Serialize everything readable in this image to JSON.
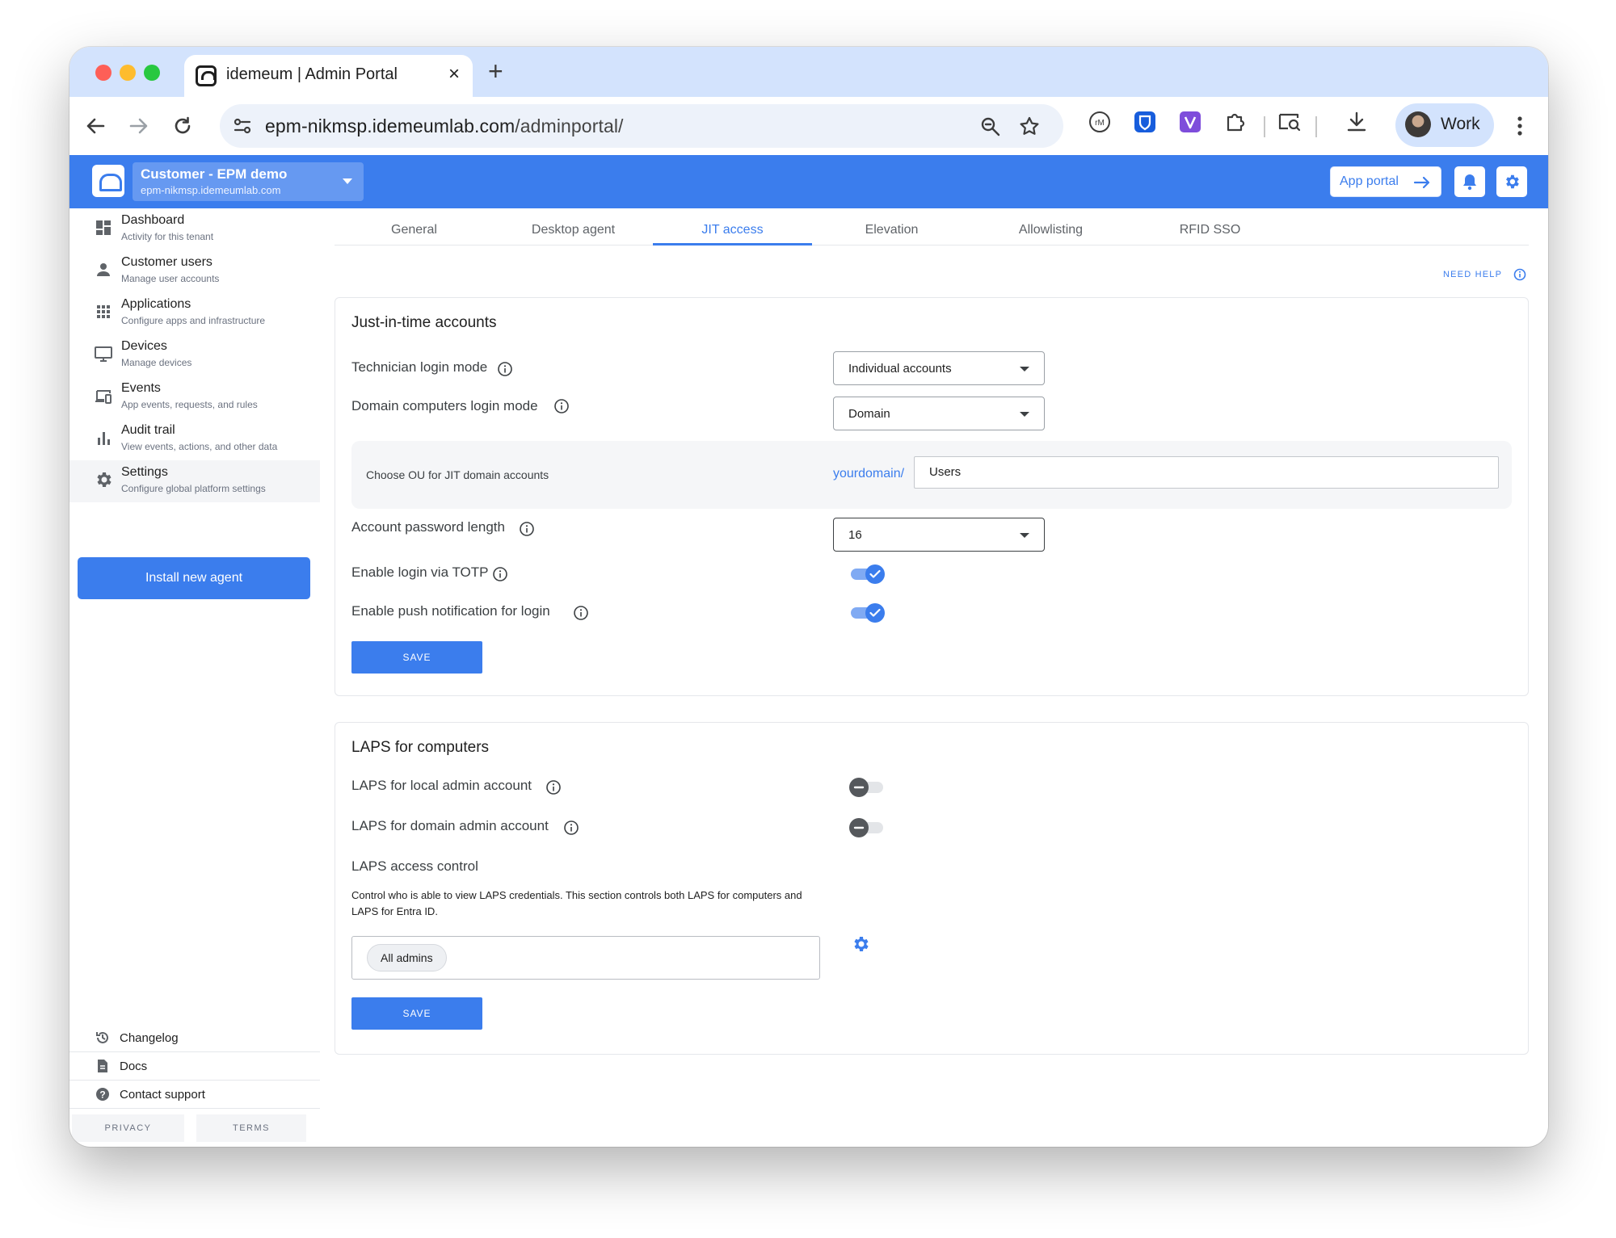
{
  "browser": {
    "tab_title": "idemeum | Admin Portal",
    "tab_close": "×",
    "new_tab": "+",
    "url_host": "epm-nikmsp.idemeumlab.com",
    "url_path": "/adminportal/",
    "profile_label": "Work"
  },
  "header": {
    "tenant_name": "Customer - EPM demo",
    "tenant_domain": "epm-nikmsp.idemeumlab.com",
    "app_portal_label": "App portal"
  },
  "sidebar": {
    "items": [
      {
        "title": "Dashboard",
        "subtitle": "Activity for this tenant",
        "icon": "dashboard-icon"
      },
      {
        "title": "Customer users",
        "subtitle": "Manage user accounts",
        "icon": "person-icon"
      },
      {
        "title": "Applications",
        "subtitle": "Configure apps and infrastructure",
        "icon": "apps-grid-icon"
      },
      {
        "title": "Devices",
        "subtitle": "Manage devices",
        "icon": "monitor-icon"
      },
      {
        "title": "Events",
        "subtitle": "App events, requests, and rules",
        "icon": "devices-icon"
      },
      {
        "title": "Audit trail",
        "subtitle": "View events, actions, and other data",
        "icon": "bar-chart-icon"
      },
      {
        "title": "Settings",
        "subtitle": "Configure global platform settings",
        "icon": "gear-icon"
      }
    ],
    "install_label": "Install new agent",
    "footer": [
      {
        "label": "Changelog",
        "icon": "history-icon"
      },
      {
        "label": "Docs",
        "icon": "document-icon"
      },
      {
        "label": "Contact support",
        "icon": "help-icon"
      }
    ],
    "privacy_label": "PRIVACY",
    "terms_label": "TERMS"
  },
  "tabs": [
    "General",
    "Desktop agent",
    "JIT access",
    "Elevation",
    "Allowlisting",
    "RFID SSO"
  ],
  "active_tab": "JIT access",
  "need_help_label": "NEED HELP",
  "jit": {
    "title": "Just-in-time accounts",
    "technician_label": "Technician login mode",
    "technician_value": "Individual accounts",
    "domain_label": "Domain computers login mode",
    "domain_value": "Domain",
    "ou_label": "Choose OU for JIT domain accounts",
    "ou_prefix": "yourdomain/",
    "ou_value": "Users",
    "password_label": "Account password length",
    "password_value": "16",
    "totp_label": "Enable login via TOTP",
    "totp_enabled": true,
    "push_label": "Enable push notification for login",
    "push_enabled": true,
    "save_label": "SAVE"
  },
  "laps": {
    "title": "LAPS for computers",
    "local_label": "LAPS for local admin account",
    "local_enabled": false,
    "domain_label": "LAPS for domain admin account",
    "domain_enabled": false,
    "access_title": "LAPS access control",
    "access_desc": "Control who is able to view LAPS credentials. This section controls both LAPS for computers and LAPS for Entra ID.",
    "chip_label": "All admins",
    "save_label": "SAVE"
  },
  "colors": {
    "accent": "#3b7ded",
    "tab_strip": "#d3e3fd",
    "omnibox": "#edf2fa"
  }
}
